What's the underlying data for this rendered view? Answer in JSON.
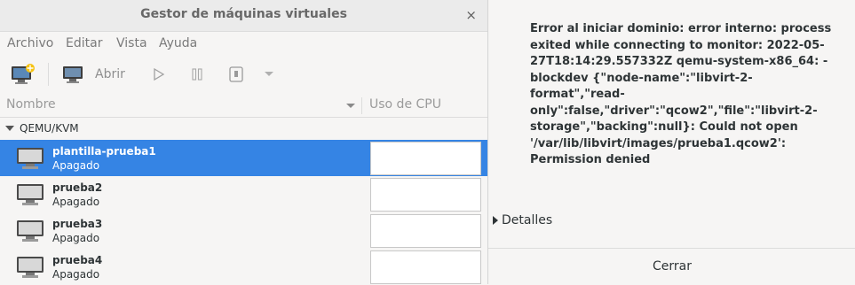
{
  "window": {
    "title": "Gestor de máquinas virtuales",
    "close_glyph": "×"
  },
  "menu": [
    "Archivo",
    "Editar",
    "Vista",
    "Ayuda"
  ],
  "toolbar": {
    "new_icon": "new-vm-icon",
    "open_icon": "monitor-icon",
    "open_label": "Abrir",
    "run_icon": "play-icon",
    "pause_icon": "pause-icon",
    "shutdown_icon": "power-icon",
    "shutdown_menu_icon": "chevron-down-icon"
  },
  "columns": {
    "name": "Nombre",
    "cpu": "Uso de CPU"
  },
  "group": {
    "label": "QEMU/KVM"
  },
  "vms": [
    {
      "name": "plantilla-prueba1",
      "state": "Apagado"
    },
    {
      "name": "prueba2",
      "state": "Apagado"
    },
    {
      "name": "prueba3",
      "state": "Apagado"
    },
    {
      "name": "prueba4",
      "state": "Apagado"
    }
  ],
  "dialog": {
    "message": "Error al iniciar dominio: error interno: process exited while connecting to monitor: 2022-05-27T18:14:29.557332Z qemu-system-x86_64: -blockdev {\"node-name\":\"libvirt-2-format\",\"read-only\":false,\"driver\":\"qcow2\",\"file\":\"libvirt-2-storage\",\"backing\":null}: Could not open '/var/lib/libvirt/images/prueba1.qcow2': Permission denied",
    "details_label": "Detalles",
    "close_button": "Cerrar"
  },
  "colors": {
    "selection": "#3584e4"
  }
}
